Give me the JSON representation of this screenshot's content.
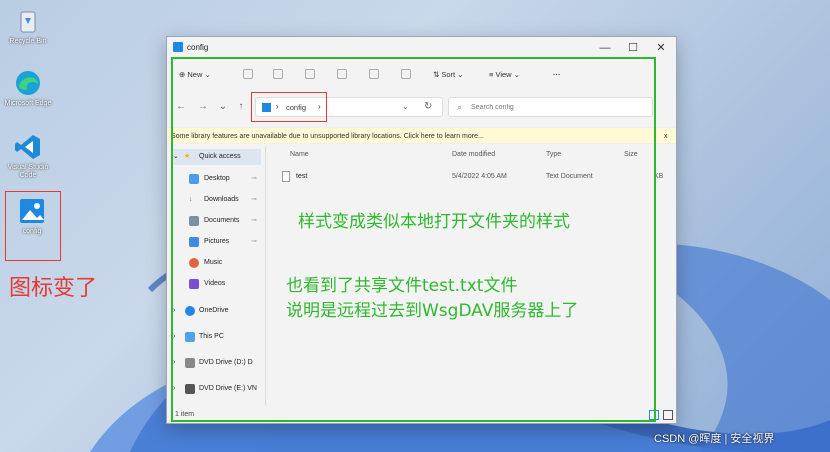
{
  "desktop": {
    "icons": [
      {
        "label": "Recycle Bin",
        "icon": "recycle-bin-icon"
      },
      {
        "label": "Microsoft Edge",
        "icon": "edge-icon"
      },
      {
        "label": "Visual Studio Code",
        "icon": "vscode-icon"
      },
      {
        "label": "config",
        "icon": "image-file-icon"
      }
    ]
  },
  "annotations": {
    "icon_changed": "图标变了",
    "style_changed": "样式变成类似本地打开文件夹的样式",
    "see_shared_file": "也看到了共享文件test.txt文件",
    "explain": "说明是远程过去到WsgDAV服务器上了"
  },
  "window": {
    "title": "config",
    "controls": {
      "minimize": "—",
      "maximize": "☐",
      "close": "✕"
    },
    "toolbar": {
      "new_label": "New",
      "sort_label": "Sort",
      "view_label": "View",
      "more_label": "···"
    },
    "address": {
      "breadcrumb": "config",
      "search_placeholder": "Search config"
    },
    "infobar": {
      "text": "Some library features are unavailable due to unsupported library locations. Click here to learn more...",
      "close": "x"
    },
    "nav": {
      "quick_access": "Quick access",
      "items": [
        "Desktop",
        "Downloads",
        "Documents",
        "Pictures",
        "Music",
        "Videos"
      ],
      "onedrive": "OneDrive",
      "thispc": "This PC",
      "dvd_d": "DVD Drive (D:) D",
      "dvd_e": "DVD Drive (E:) VN"
    },
    "columns": {
      "name": "Name",
      "date": "Date modified",
      "type": "Type",
      "size": "Size"
    },
    "files": [
      {
        "name": "test",
        "date": "5/4/2022 4:05 AM",
        "type": "Text Document",
        "size": "KB"
      }
    ],
    "status": "1 item"
  },
  "watermark": "CSDN @晖度 | 安全视界",
  "colors": {
    "annotation_green": "#2eb82e",
    "annotation_red": "#e53935",
    "accent": "#1e88e5"
  }
}
